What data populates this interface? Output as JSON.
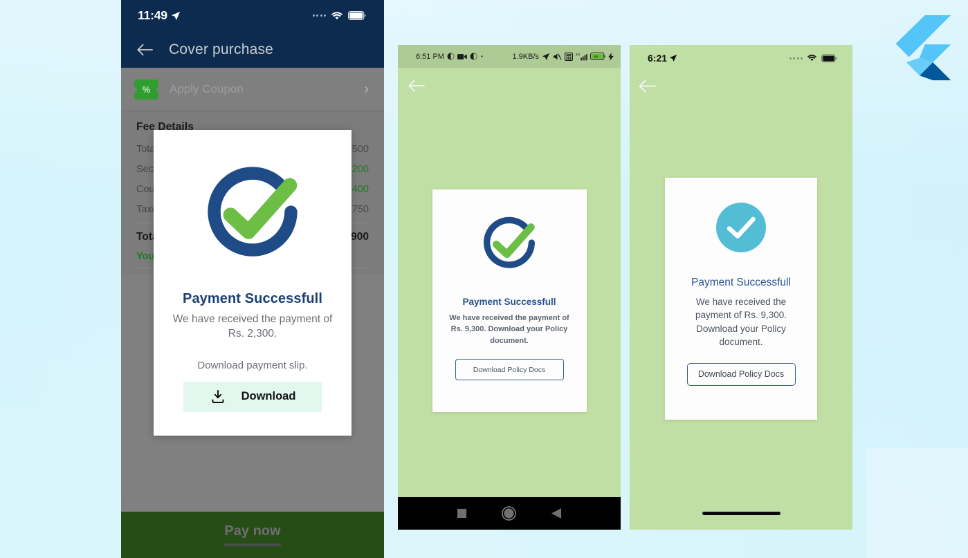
{
  "background": {
    "color": "#d6f4fb",
    "panel_color": "#ffffff"
  },
  "brand": {
    "logo_name": "flutter-logo",
    "logo_colors": [
      "#54c5f8",
      "#29b6f6",
      "#01579b"
    ]
  },
  "phone1": {
    "status_bar": {
      "time": "11:49",
      "location_icon": "location-arrow-icon",
      "signal_dots_icon": "signal-dots-icon",
      "wifi_icon": "wifi-icon",
      "battery_icon": "battery-icon"
    },
    "app_bar": {
      "back_icon": "back-arrow-icon",
      "title": "Cover purchase"
    },
    "coupon": {
      "badge_text": "%",
      "label": "Apply Coupon",
      "chevron": "›"
    },
    "fee_details": {
      "heading": "Fee Details",
      "rows": [
        {
          "label": "Total",
          "value": "3,500",
          "green": false
        },
        {
          "label": "SecuR",
          "value": "4,200",
          "green": true
        },
        {
          "label": "Coupe",
          "value": "- 400",
          "green": true
        },
        {
          "label": "Taxex",
          "value": "750",
          "green": false
        }
      ],
      "total": {
        "label": "Total",
        "value": "3,900"
      },
      "savings": "You w"
    },
    "pay_button": "Pay now"
  },
  "dialog": {
    "icon_name": "circle-check-icon",
    "icon_colors": {
      "ring": "#1f4b87",
      "check": "#6cbe45"
    },
    "title": "Payment Successfull",
    "message": "We have received the payment of Rs. 2,300.",
    "note": "Download payment slip.",
    "button": {
      "label": "Download",
      "icon_name": "download-icon",
      "background": "#e2f7ee"
    }
  },
  "phone2": {
    "status_bar": {
      "time": "6:51 PM",
      "left_icons": [
        "brightness-icon",
        "video-camera-icon",
        "brightness-icon",
        "dot-icon"
      ],
      "network_speed": "1.9KB/s",
      "right_icons": [
        "location-arrow-icon",
        "mute-icon",
        "calculator-icon",
        "signal-4g-icon",
        "battery-charging-icon",
        "bolt-icon"
      ],
      "battery_level": "65"
    },
    "app_bar": {
      "back_icon": "back-arrow-icon"
    },
    "card": {
      "icon_name": "circle-check-icon",
      "title": "Payment Successfull",
      "message": "We have received the payment of Rs. 9,300. Download your Policy document.",
      "button_label": "Download Policy Docs"
    },
    "nav_bar": {
      "recents_icon": "square-icon",
      "home_icon": "circle-icon",
      "back_icon": "triangle-back-icon"
    }
  },
  "phone3": {
    "status_bar": {
      "time": "6:21",
      "location_icon": "location-arrow-icon",
      "signal_dots_icon": "signal-dots-icon",
      "wifi_icon": "wifi-icon",
      "battery_icon": "battery-icon"
    },
    "app_bar": {
      "back_icon": "back-arrow-icon"
    },
    "card": {
      "icon_name": "circle-check-filled-icon",
      "icon_color": "#54bdd6",
      "title": "Payment Successfull",
      "message": "We have received the payment of Rs. 9,300. Download your Policy document.",
      "button_label": "Download Policy Docs"
    },
    "home_indicator": "home-indicator-bar"
  }
}
